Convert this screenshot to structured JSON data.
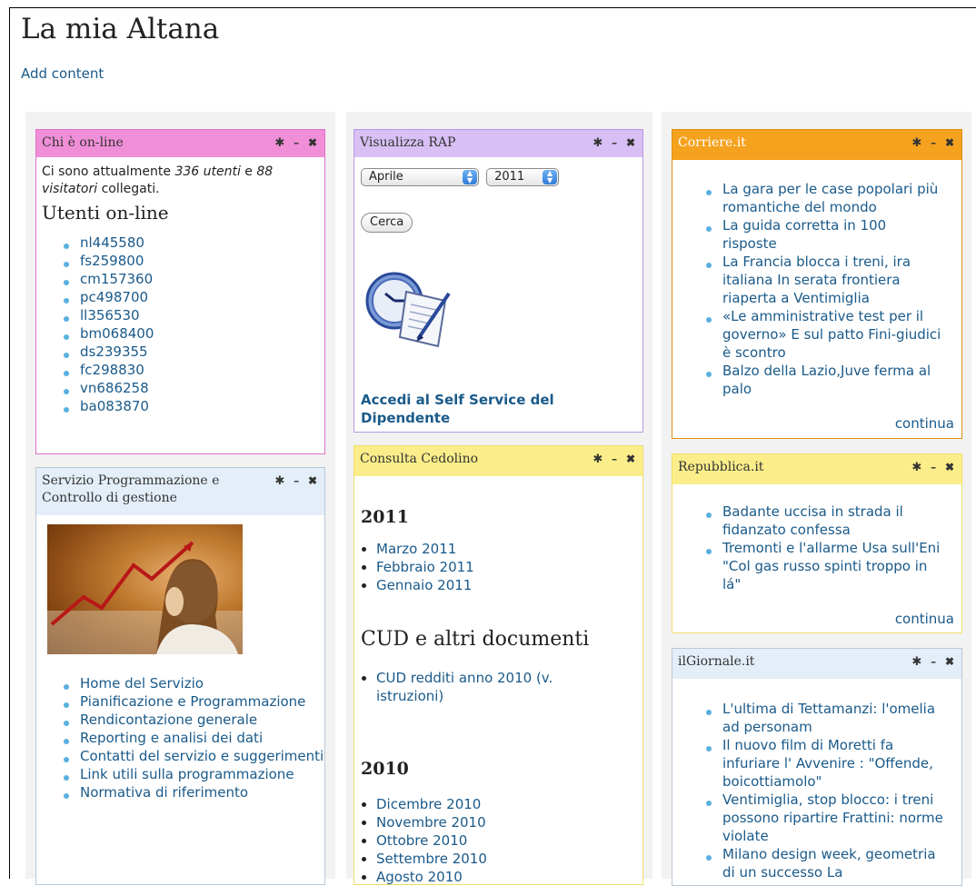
{
  "page": {
    "title": "La mia Altana",
    "add_content": "Add content"
  },
  "controls": {
    "gear": "✱",
    "minimize": "–",
    "close": "✖"
  },
  "online": {
    "title": "Chi è on-line",
    "text_before": "Ci sono attualmente ",
    "users_count": "336 utenti",
    "text_mid": " e ",
    "visitors_count": "88 visitatori",
    "text_after": " collegati.",
    "heading": "Utenti on-line",
    "users": [
      "nl445580",
      "fs259800",
      "cm157360",
      "pc498700",
      "ll356530",
      "bm068400",
      "ds239355",
      "fc298830",
      "vn686258",
      "ba083870"
    ]
  },
  "servizio": {
    "title": "Servizio Programmazione e Controllo di gestione",
    "links": [
      "Home del Servizio",
      "Pianificazione e Programmazione",
      "Rendicontazione generale",
      "Reporting e analisi dei dati",
      "Contatti del servizio e suggerimenti",
      "Link utili sulla programmazione",
      "Normativa di riferimento"
    ]
  },
  "rap": {
    "title": "Visualizza RAP",
    "month": "Aprile",
    "year": "2011",
    "search_button": "Cerca",
    "self_service": "Accedi al Self Service del Dipendente"
  },
  "cedolino": {
    "title": "Consulta Cedolino",
    "year_2011": "2011",
    "items_2011": [
      "Marzo 2011",
      "Febbraio 2011",
      "Gennaio 2011"
    ],
    "cud_heading": "CUD e altri documenti",
    "cud_item": "CUD redditi anno 2010 (v. istruzioni)",
    "year_2010": "2010",
    "items_2010": [
      "Dicembre 2010",
      "Novembre 2010",
      "Ottobre 2010",
      "Settembre 2010",
      "Agosto 2010"
    ]
  },
  "corriere": {
    "title": "Corriere.it",
    "items": [
      "La gara per le case popolari più romantiche del mondo",
      "La guida corretta in 100 risposte",
      "La Francia blocca i treni, ira italiana In serata frontiera riaperta a Ventimiglia",
      "«Le amministrative test per il governo» E sul patto Fini-giudici è scontro",
      "Balzo della Lazio,Juve ferma al palo"
    ],
    "more": "continua"
  },
  "repubblica": {
    "title": "Repubblica.it",
    "items": [
      "Badante uccisa in strada il fidanzato confessa",
      "Tremonti e l'allarme Usa sull'Eni \"Col gas russo spinti troppo in lá\""
    ],
    "more": "continua"
  },
  "giornale": {
    "title": "ilGiornale.it",
    "items": [
      "L'ultima di Tettamanzi: l'omelia ad personam",
      "Il nuovo film di Moretti fa infuriare l' Avvenire : \"Offende, boicottiamolo\"",
      "Ventimiglia, stop blocco: i treni possono ripartire Frattini: norme violate",
      "Milano design week, geometria di un successo La"
    ]
  },
  "colors": {
    "link": "#1a5a8a",
    "online_header": "#f08fd8",
    "rap_header": "#d8c0f4",
    "cedolino_header": "#fbee8a",
    "corriere_header": "#f5a21e",
    "repubblica_header": "#fbee8a",
    "giornale_header": "#e4eef8",
    "servizio_header": "#e4eef8"
  }
}
